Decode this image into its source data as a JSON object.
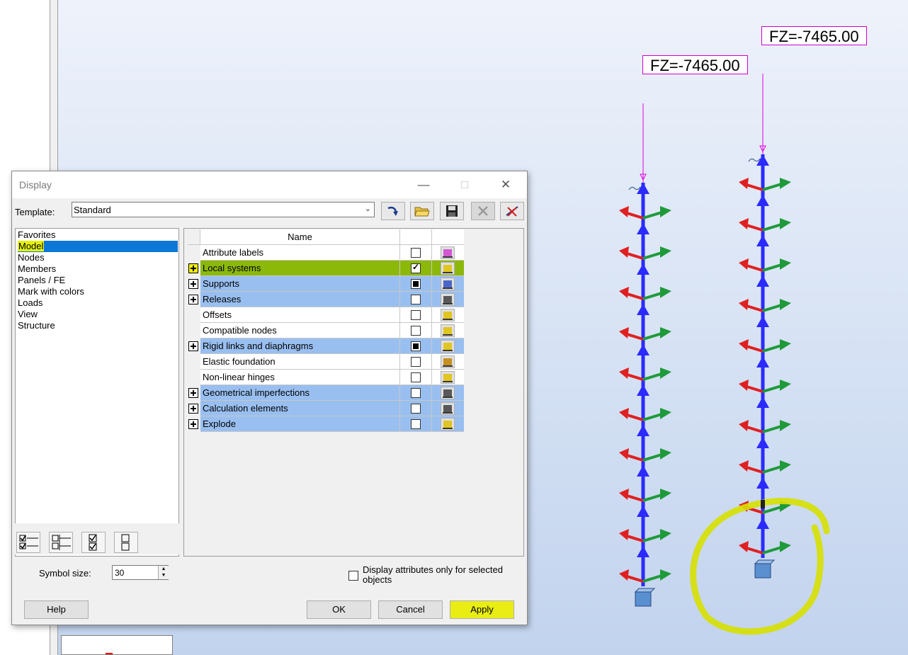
{
  "dialog": {
    "title": "Display",
    "template_label": "Template:",
    "template_value": "Standard",
    "toolbar_icons": [
      "redo-arrow-icon",
      "open-folder-icon",
      "save-icon",
      "delete-icon",
      "delete-all-icon"
    ],
    "categories": [
      {
        "label": "Favorites",
        "selected": false
      },
      {
        "label": "Model",
        "selected": true
      },
      {
        "label": "Nodes",
        "selected": false
      },
      {
        "label": "Members",
        "selected": false
      },
      {
        "label": "Panels / FE",
        "selected": false
      },
      {
        "label": "Mark with colors",
        "selected": false
      },
      {
        "label": "Loads",
        "selected": false
      },
      {
        "label": "View",
        "selected": false
      },
      {
        "label": "Structure",
        "selected": false
      }
    ],
    "table": {
      "header_name": "Name",
      "rows": [
        {
          "label": "Attribute labels",
          "expandable": false,
          "check": "empty",
          "style": "white",
          "icon": "attribute-labels-icon"
        },
        {
          "label": "Local systems",
          "expandable": true,
          "check": "checked",
          "style": "hl",
          "icon": "local-systems-icon"
        },
        {
          "label": "Supports",
          "expandable": true,
          "check": "filled",
          "style": "blue",
          "icon": "supports-icon"
        },
        {
          "label": "Releases",
          "expandable": true,
          "check": "empty",
          "style": "blue",
          "icon": "releases-icon"
        },
        {
          "label": "Offsets",
          "expandable": false,
          "check": "empty",
          "style": "white",
          "icon": "offsets-icon"
        },
        {
          "label": "Compatible nodes",
          "expandable": false,
          "check": "empty",
          "style": "white",
          "icon": "compatible-nodes-icon"
        },
        {
          "label": "Rigid links and diaphragms",
          "expandable": true,
          "check": "filled",
          "style": "blue",
          "icon": "rigid-links-icon"
        },
        {
          "label": "Elastic foundation",
          "expandable": false,
          "check": "empty",
          "style": "white",
          "icon": "elastic-foundation-icon"
        },
        {
          "label": "Non-linear hinges",
          "expandable": false,
          "check": "empty",
          "style": "white",
          "icon": "hinges-icon"
        },
        {
          "label": "Geometrical imperfections",
          "expandable": true,
          "check": "empty",
          "style": "blue",
          "icon": "imperfections-icon"
        },
        {
          "label": "Calculation elements",
          "expandable": true,
          "check": "empty",
          "style": "blue",
          "icon": "calculation-elements-icon"
        },
        {
          "label": "Explode",
          "expandable": true,
          "check": "empty",
          "style": "blue",
          "icon": "explode-icon"
        }
      ]
    },
    "symbol_size_label": "Symbol size:",
    "symbol_size_value": "30",
    "display_attr_label": "Display attributes only for selected objects",
    "buttons": {
      "help": "Help",
      "ok": "OK",
      "cancel": "Cancel",
      "apply": "Apply"
    }
  },
  "viewport": {
    "load_label_left": "FZ=-7465.00",
    "load_label_right": "FZ=-7465.00",
    "colors": {
      "member": "#2b2bff",
      "x_axis": "#e02020",
      "y_axis": "#1f9a3a",
      "load": "#e000e0",
      "highlight": "#d7e000",
      "support": "#5a8fd0"
    }
  }
}
